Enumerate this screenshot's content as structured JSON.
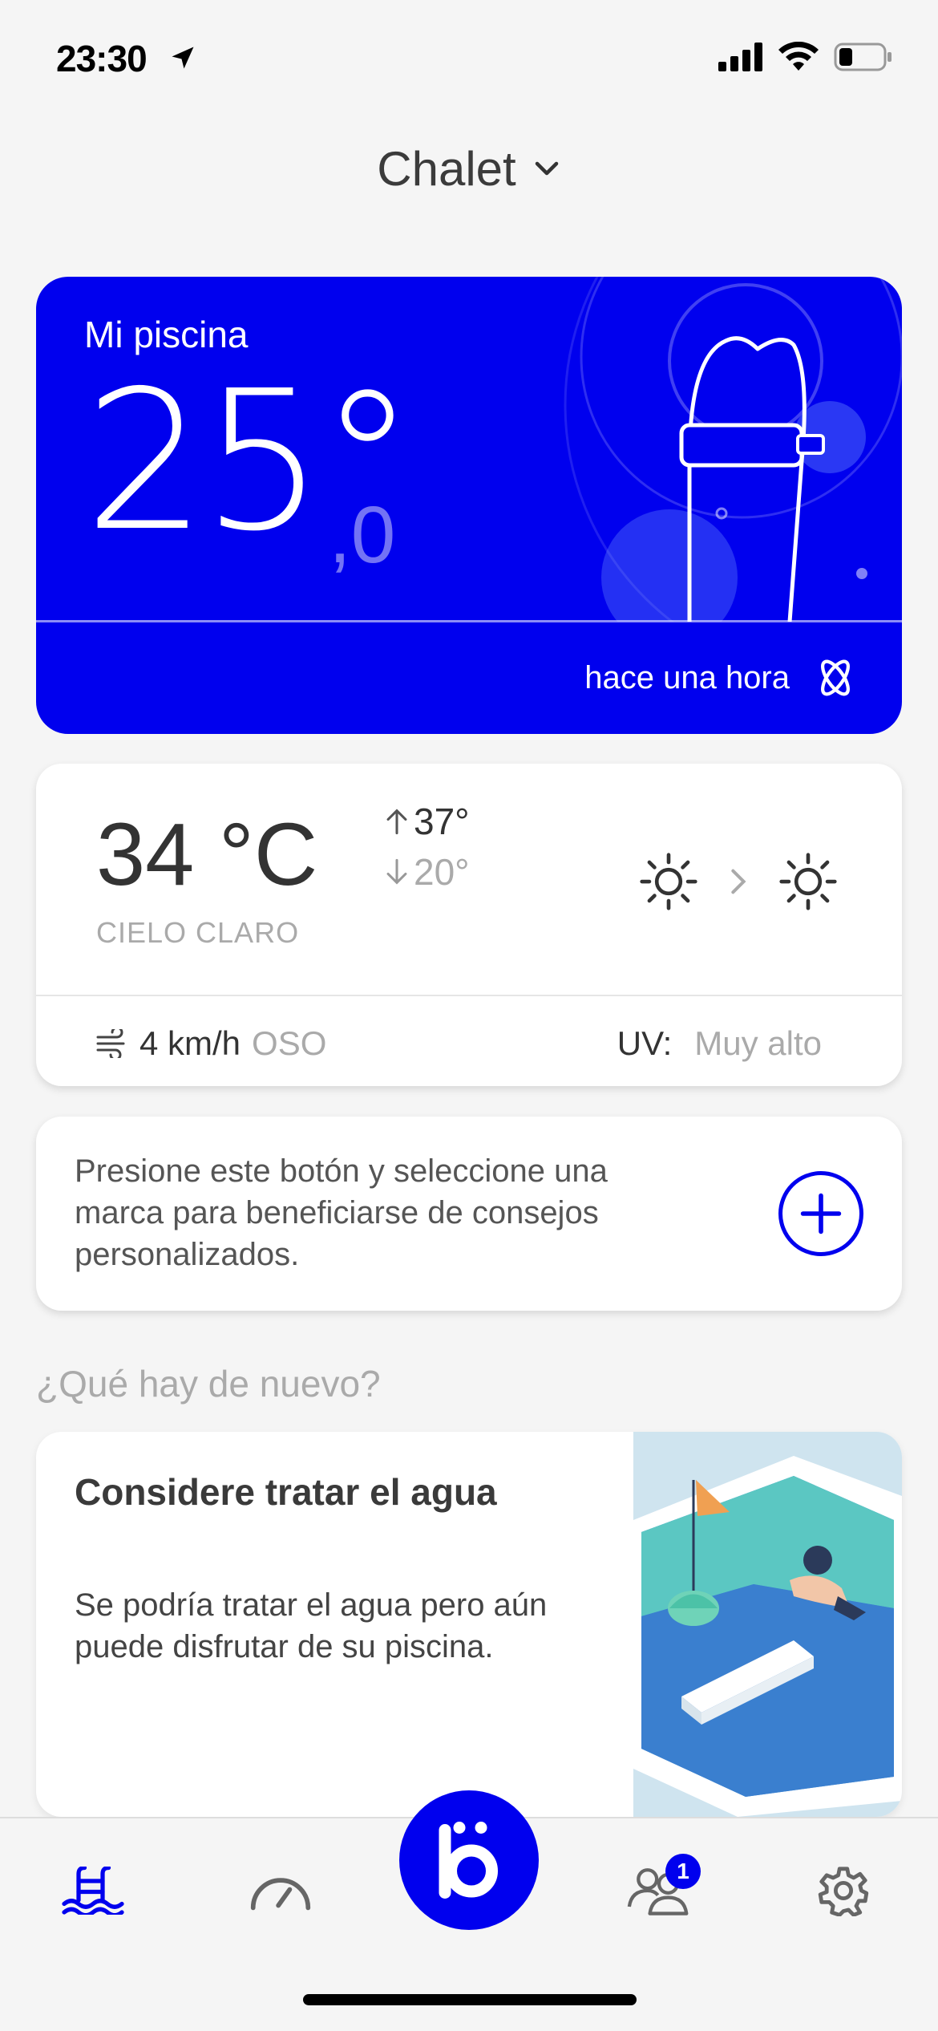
{
  "status_bar": {
    "time": "23:30"
  },
  "header": {
    "location": "Chalet"
  },
  "pool": {
    "title": "Mi piscina",
    "temperature": "25°",
    "decimal": ",0",
    "updated": "hace una hora",
    "accent_color": "#0000ee"
  },
  "weather": {
    "temperature": "34 °C",
    "max": "37°",
    "min": "20°",
    "condition": "CIELO CLARO",
    "wind_speed": "4 km/h",
    "wind_direction": "OSO",
    "uv_label": "UV:",
    "uv_value": "Muy alto",
    "icons": [
      "sun-icon",
      "chevron-right-icon",
      "sun-icon"
    ]
  },
  "brand_prompt": {
    "text": "Presione este botón y seleccione una marca para beneficiarse de consejos personalizados."
  },
  "news": {
    "heading": "¿Qué hay de nuevo?",
    "title": "Considere tratar el agua",
    "body": "Se podría tratar el agua pero aún puede disfrutar de su piscina."
  },
  "tab_bar": {
    "tabs": [
      "pool-tab",
      "dashboard-tab",
      "brand-tab",
      "community-tab",
      "settings-tab"
    ],
    "community_badge": "1",
    "active_tab": "pool-tab"
  }
}
